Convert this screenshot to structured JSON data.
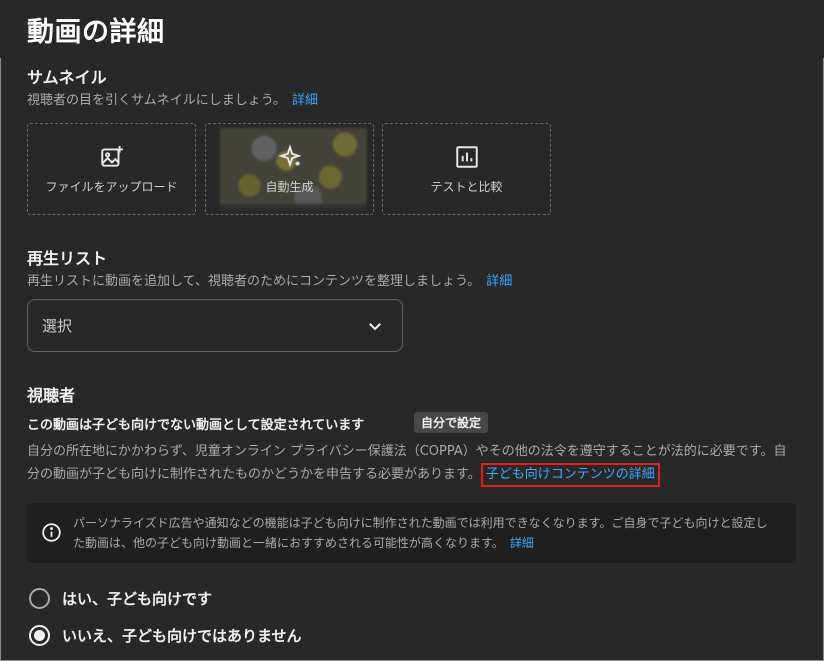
{
  "page": {
    "title": "動画の詳細"
  },
  "thumbnail": {
    "title": "サムネイル",
    "description": "視聴者の目を引くサムネイルにしましょう。",
    "link": "詳細",
    "options": [
      {
        "label": "ファイルをアップロード",
        "icon": "image-add-icon"
      },
      {
        "label": "自動生成",
        "icon": "sparkle-icon"
      },
      {
        "label": "テストと比較",
        "icon": "bar-chart-icon"
      }
    ]
  },
  "playlist": {
    "title": "再生リスト",
    "description": "再生リストに動画を追加して、視聴者のためにコンテンツを整理しましょう。",
    "link": "詳細",
    "select_value": "選択"
  },
  "audience": {
    "title": "視聴者",
    "status": "この動画は子ども向けでない動画として設定されています",
    "badge": "自分で設定",
    "paragraph": "自分の所在地にかかわらず、児童オンライン プライバシー保護法（COPPA）やその他の法令を遵守することが法的に必要です。自分の動画が子ども向けに制作されたものかどうかを申告する必要があります。",
    "paragraph_link": "子ども向けコンテンツの詳細",
    "info_text": "パーソナライズド広告や通知などの機能は子ども向けに制作された動画では利用できなくなります。ご自身で子ども向けと設定した動画は、他の子ども向け動画と一緒におすすめされる可能性が高くなります。",
    "info_link": "詳細",
    "radio_yes": "はい、子ども向けです",
    "radio_no": "いいえ、子ども向けではありません",
    "selected": "no"
  }
}
